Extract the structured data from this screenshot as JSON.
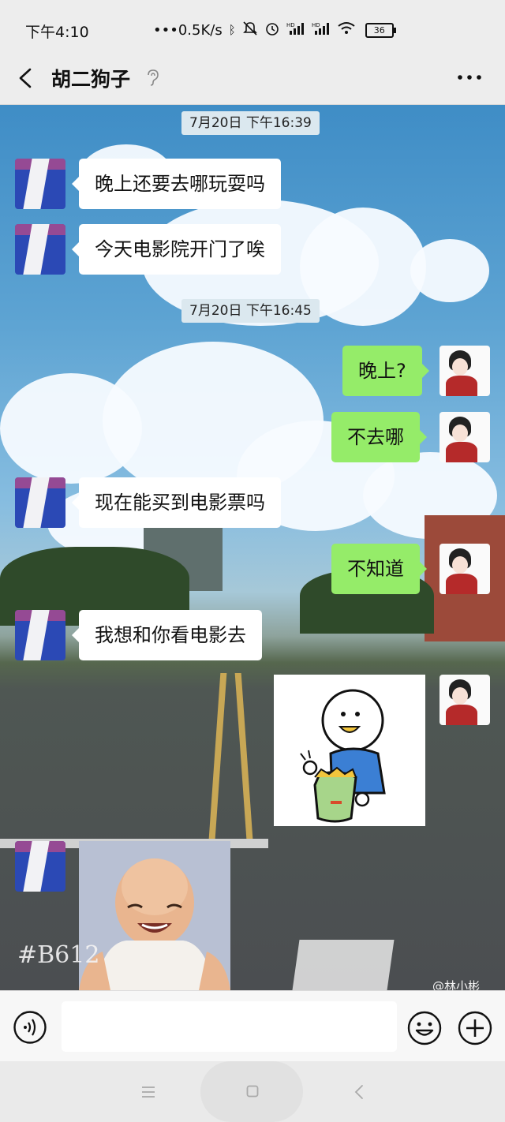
{
  "status_bar": {
    "time": "下午4:10",
    "network_speed": "•••0.5K/s",
    "battery": "36",
    "icons": [
      "bluetooth-icon",
      "mute-icon",
      "alarm-icon",
      "signal-hd-icon",
      "signal-hd-icon",
      "wifi-icon",
      "battery-icon"
    ]
  },
  "header": {
    "title": "胡二狗子",
    "back_icon": "chevron-left-icon",
    "ear_icon": "ear-icon",
    "more_icon": "more-dots-icon"
  },
  "messages": [
    {
      "type": "timestamp",
      "text": "7月20日 下午16:39"
    },
    {
      "type": "text",
      "side": "left",
      "text": "晚上还要去哪玩耍吗"
    },
    {
      "type": "text",
      "side": "left",
      "text": "今天电影院开门了唉"
    },
    {
      "type": "timestamp",
      "text": "7月20日 下午16:45"
    },
    {
      "type": "text",
      "side": "right",
      "text": "晚上?"
    },
    {
      "type": "text",
      "side": "right",
      "text": "不去哪"
    },
    {
      "type": "text",
      "side": "left",
      "text": "现在能买到电影票吗"
    },
    {
      "type": "text",
      "side": "right",
      "text": "不知道"
    },
    {
      "type": "text",
      "side": "left",
      "text": "我想和你看电影去"
    },
    {
      "type": "sticker",
      "side": "right",
      "description": "cartoon-eating-chips-sticker"
    },
    {
      "type": "image",
      "side": "left",
      "description": "smiling-baby-photo"
    }
  ],
  "watermarks": {
    "left": "#B612",
    "right": "@林小彬"
  },
  "input_bar": {
    "text_value": "",
    "voice_icon": "voice-icon",
    "emoji_icon": "emoji-icon",
    "plus_icon": "plus-icon"
  },
  "colors": {
    "sent_bubble": "#95ec69",
    "received_bubble": "#ffffff",
    "timestamp_bg": "#dbe8ef"
  }
}
